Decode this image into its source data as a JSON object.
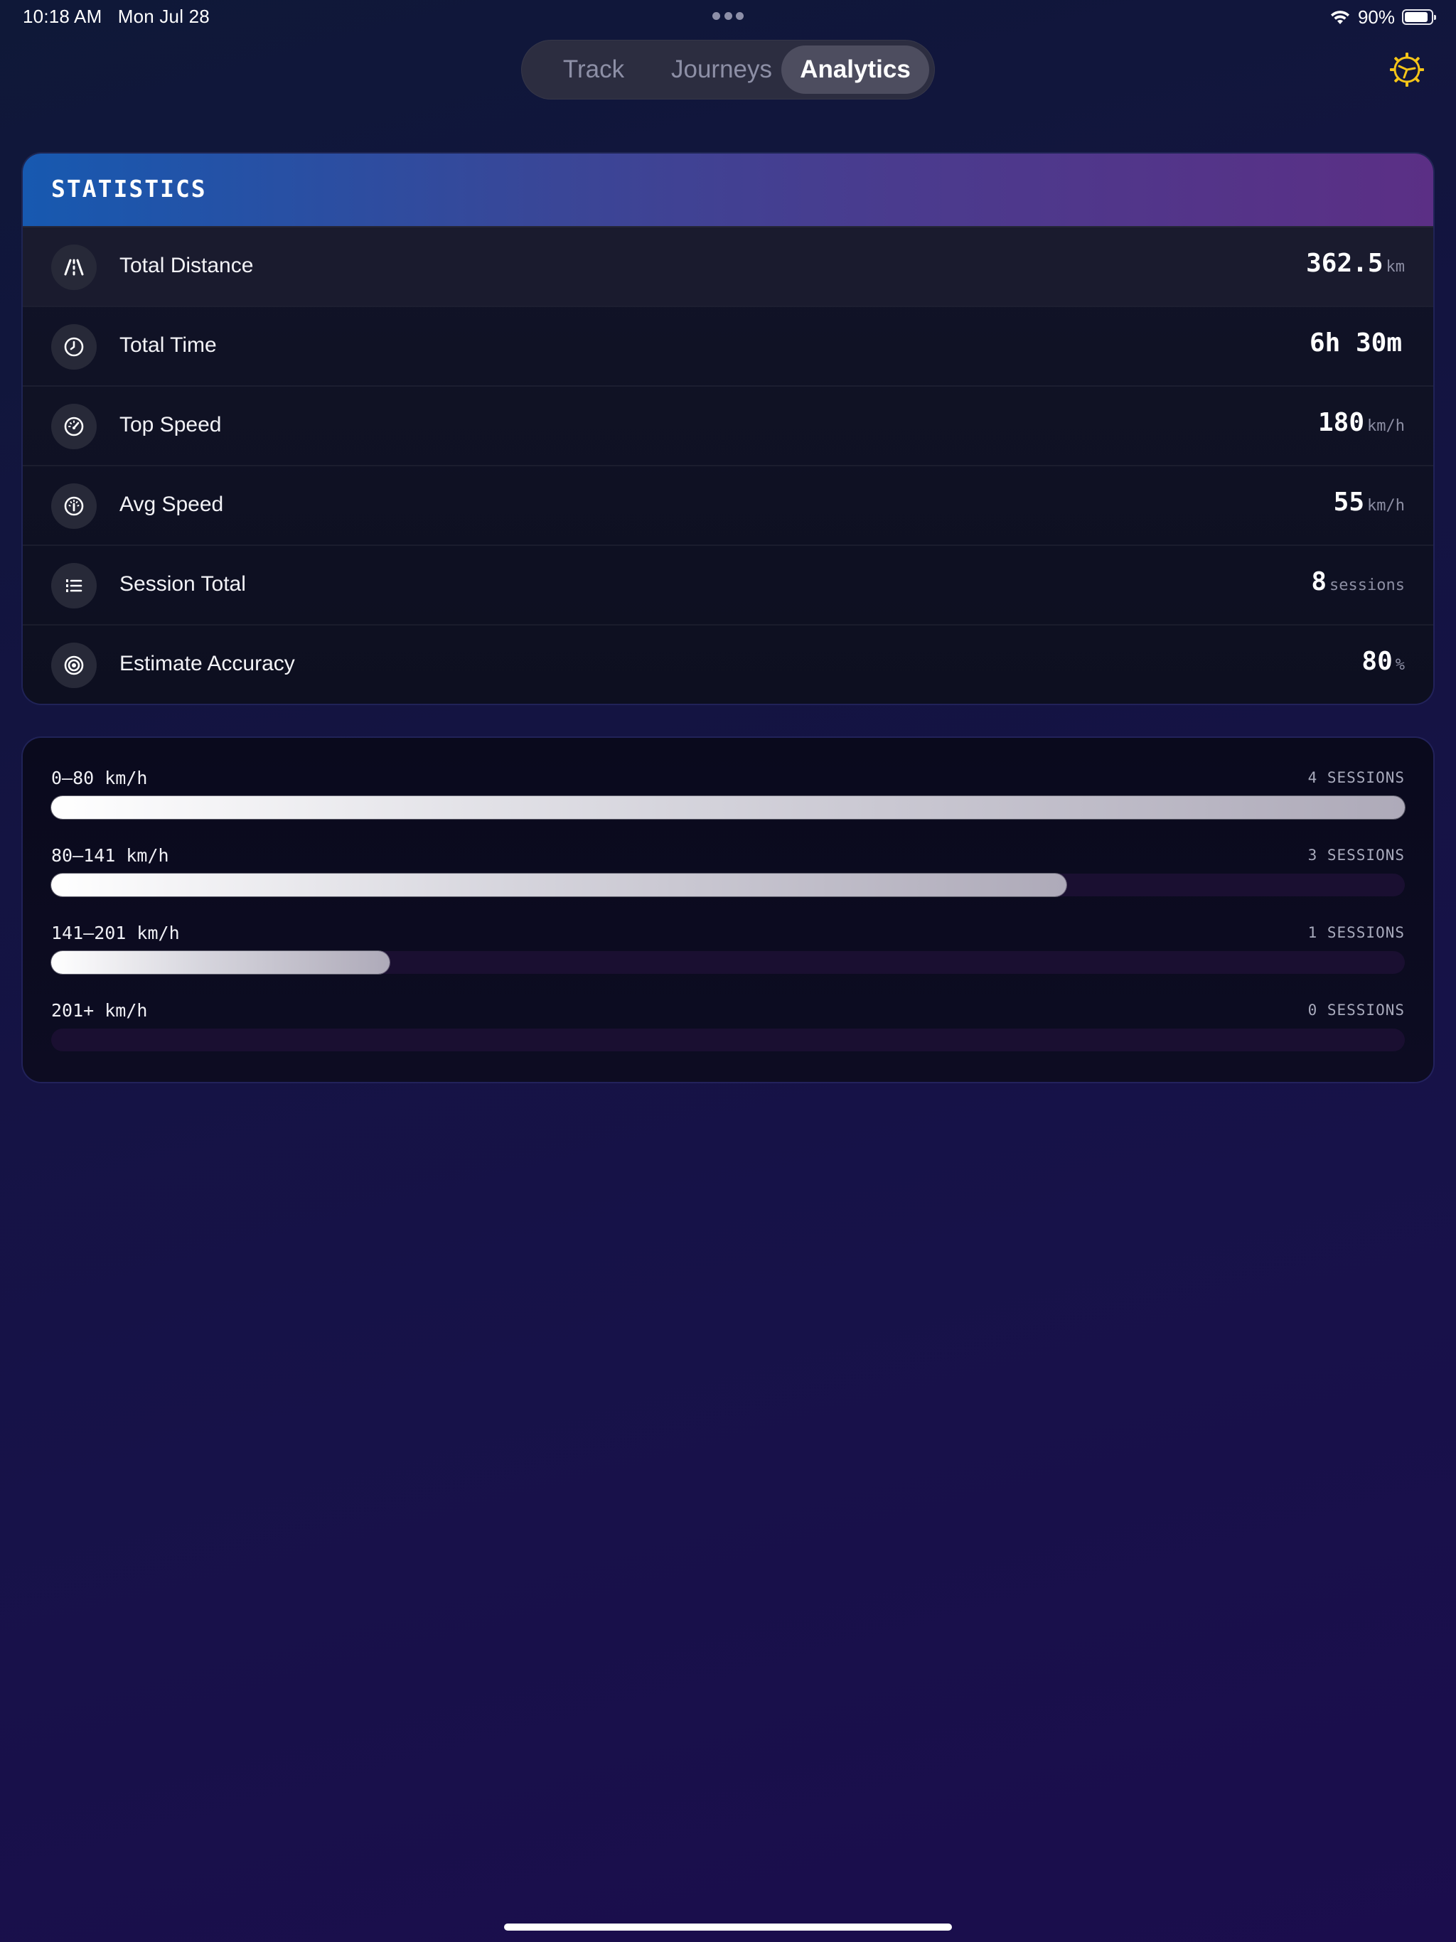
{
  "status_bar": {
    "time": "10:18 AM",
    "date": "Mon Jul 28",
    "battery_percent": "90%",
    "battery_level": 0.9
  },
  "nav": {
    "tabs": [
      {
        "label": "Track",
        "selected": false
      },
      {
        "label": "Journeys",
        "selected": false
      },
      {
        "label": "Analytics",
        "selected": true
      }
    ],
    "settings_icon": "gear-steering-icon",
    "accent_color": "#f5c518"
  },
  "statistics": {
    "title": "STATISTICS",
    "rows": [
      {
        "icon": "road-icon",
        "label": "Total Distance",
        "value": "362.5",
        "unit": "km"
      },
      {
        "icon": "clock-icon",
        "label": "Total Time",
        "value": "6h 30m",
        "unit": ""
      },
      {
        "icon": "speedometer-icon",
        "label": "Top Speed",
        "value": "180",
        "unit": "km/h"
      },
      {
        "icon": "gauge-icon",
        "label": "Avg Speed",
        "value": "55",
        "unit": "km/h"
      },
      {
        "icon": "list-icon",
        "label": "Session Total",
        "value": "8",
        "unit": "sessions"
      },
      {
        "icon": "target-icon",
        "label": "Estimate Accuracy",
        "value": "80",
        "unit": "%"
      }
    ]
  },
  "speed_distribution": {
    "rows": [
      {
        "range": "0–80 km/h",
        "count_label": "4 SESSIONS",
        "fraction": 1.0
      },
      {
        "range": "80–141 km/h",
        "count_label": "3 SESSIONS",
        "fraction": 0.75
      },
      {
        "range": "141–201 km/h",
        "count_label": "1 SESSIONS",
        "fraction": 0.25
      },
      {
        "range": "201+ km/h",
        "count_label": "0 SESSIONS",
        "fraction": 0.0
      }
    ]
  }
}
